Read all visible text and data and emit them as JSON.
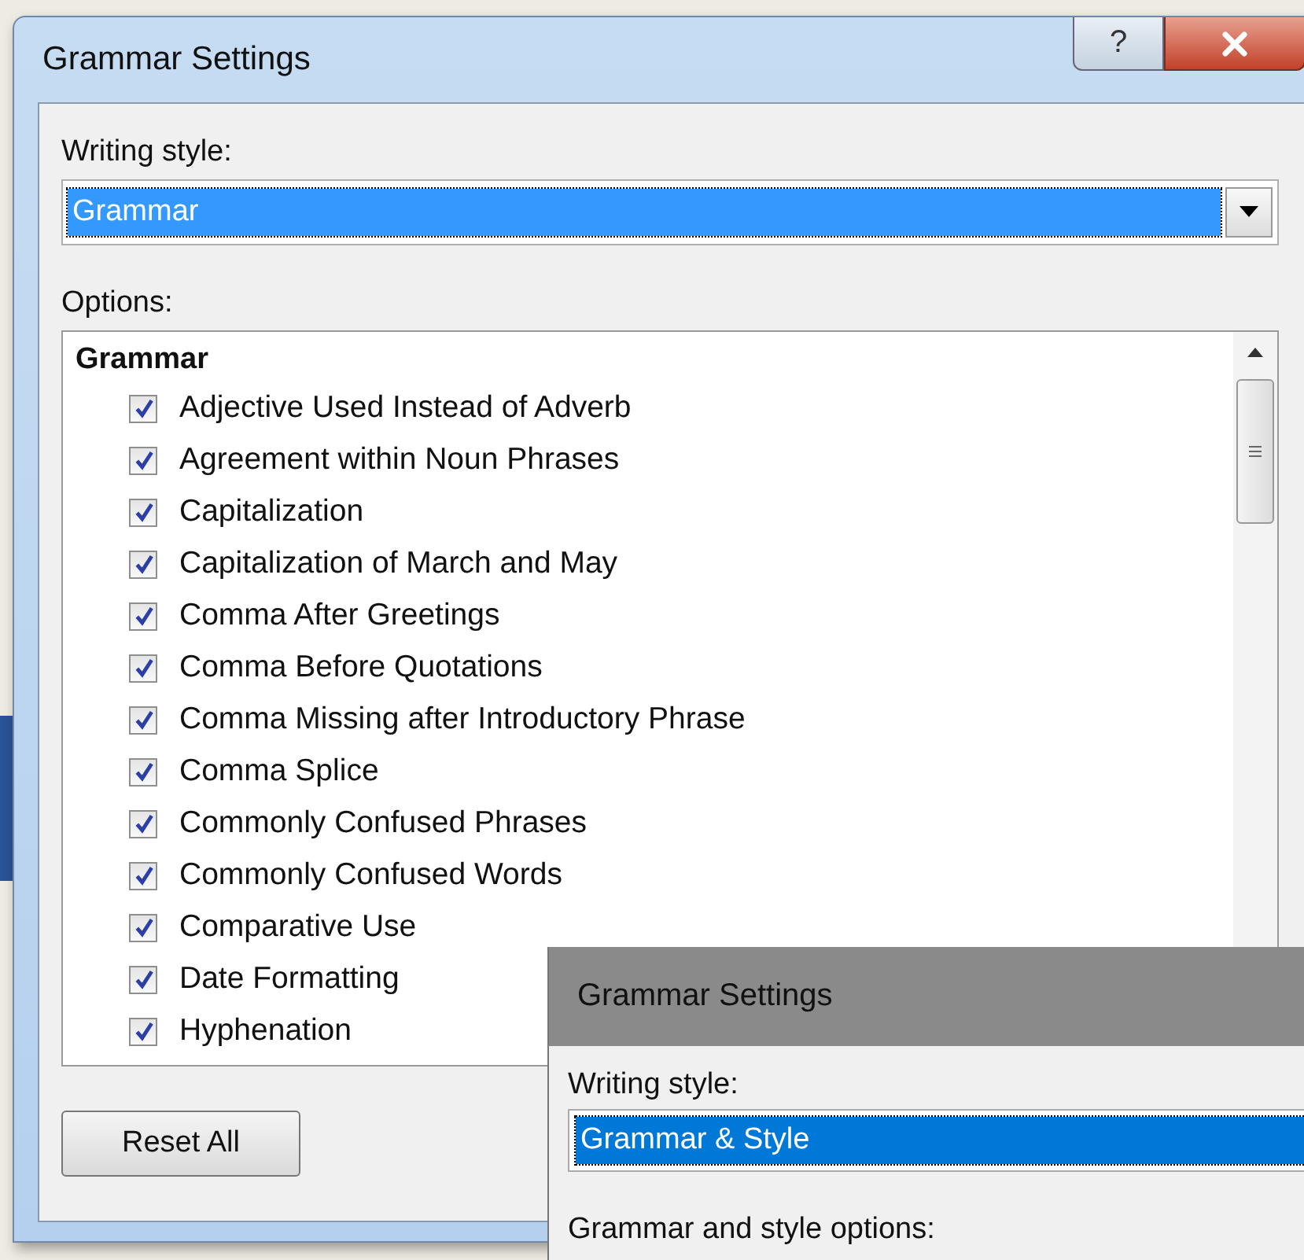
{
  "dialog": {
    "title": "Grammar Settings",
    "writing_style_label": "Writing style:",
    "writing_style_value": "Grammar",
    "options_label": "Options:",
    "group_heading": "Grammar",
    "options": [
      {
        "label": "Adjective Used Instead of Adverb",
        "checked": true
      },
      {
        "label": "Agreement within Noun Phrases",
        "checked": true
      },
      {
        "label": "Capitalization",
        "checked": true
      },
      {
        "label": "Capitalization of March and May",
        "checked": true
      },
      {
        "label": "Comma After Greetings",
        "checked": true
      },
      {
        "label": "Comma Before Quotations",
        "checked": true
      },
      {
        "label": "Comma Missing after Introductory Phrase",
        "checked": true
      },
      {
        "label": "Comma Splice",
        "checked": true
      },
      {
        "label": "Commonly Confused Phrases",
        "checked": true
      },
      {
        "label": "Commonly Confused Words",
        "checked": true
      },
      {
        "label": "Comparative Use",
        "checked": true
      },
      {
        "label": "Date Formatting",
        "checked": true
      },
      {
        "label": "Hyphenation",
        "checked": true
      }
    ],
    "reset_button": "Reset All",
    "help_button": "?"
  },
  "second_dialog": {
    "title": "Grammar Settings",
    "writing_style_label": "Writing style:",
    "writing_style_value": "Grammar & Style",
    "options_label": "Grammar and style options:"
  }
}
